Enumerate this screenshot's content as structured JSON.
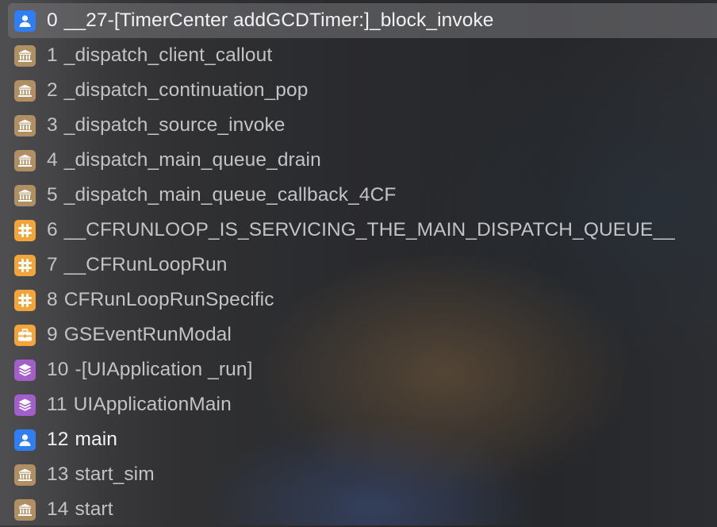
{
  "frames": [
    {
      "index": "0",
      "symbol": "__27-[TimerCenter addGCDTimer:]_block_invoke",
      "icon": "user-icon",
      "selected": true
    },
    {
      "index": "1",
      "symbol": "_dispatch_client_callout",
      "icon": "library-icon"
    },
    {
      "index": "2",
      "symbol": "_dispatch_continuation_pop",
      "icon": "library-icon"
    },
    {
      "index": "3",
      "symbol": "_dispatch_source_invoke",
      "icon": "library-icon"
    },
    {
      "index": "4",
      "symbol": "_dispatch_main_queue_drain",
      "icon": "library-icon"
    },
    {
      "index": "5",
      "symbol": "_dispatch_main_queue_callback_4CF",
      "icon": "library-icon"
    },
    {
      "index": "6",
      "symbol": "__CFRUNLOOP_IS_SERVICING_THE_MAIN_DISPATCH_QUEUE__",
      "icon": "corefoundation-icon"
    },
    {
      "index": "7",
      "symbol": "__CFRunLoopRun",
      "icon": "corefoundation-icon"
    },
    {
      "index": "8",
      "symbol": "CFRunLoopRunSpecific",
      "icon": "corefoundation-icon"
    },
    {
      "index": "9",
      "symbol": "GSEventRunModal",
      "icon": "toolbox-icon"
    },
    {
      "index": "10",
      "symbol": "-[UIApplication _run]",
      "icon": "layers-icon"
    },
    {
      "index": "11",
      "symbol": "UIApplicationMain",
      "icon": "layers-icon"
    },
    {
      "index": "12",
      "symbol": "main",
      "icon": "user-icon"
    },
    {
      "index": "13",
      "symbol": "start_sim",
      "icon": "library-icon"
    },
    {
      "index": "14",
      "symbol": "start",
      "icon": "library-icon"
    }
  ],
  "colors": {
    "user": "#2f7ef3",
    "library": "#b08f62",
    "corefoundation": "#f2a53b",
    "uikit": "#a25fc9",
    "selection": "#6e6e72"
  }
}
